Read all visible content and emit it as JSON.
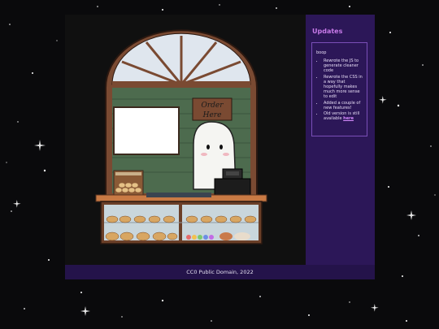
{
  "sidebar": {
    "title": "Updates",
    "heading": "boop",
    "items": [
      {
        "text": "Rewrote the JS to generate cleaner code"
      },
      {
        "text": "Rewrote the CSS in a way that hopefully makes much more sense to edit"
      },
      {
        "text": "Added a couple of new features!"
      },
      {
        "text": "Old version is still available ",
        "link": "here"
      }
    ]
  },
  "scene": {
    "sign_text": [
      "Order",
      "Here"
    ]
  },
  "footer": {
    "text": "CC0 Public Domain, 2022"
  },
  "colors": {
    "background": "#0a0a0c",
    "sidebar": "#2c1758",
    "accent": "#c77ae8",
    "link": "#d78cff",
    "footer": "#24134a"
  }
}
